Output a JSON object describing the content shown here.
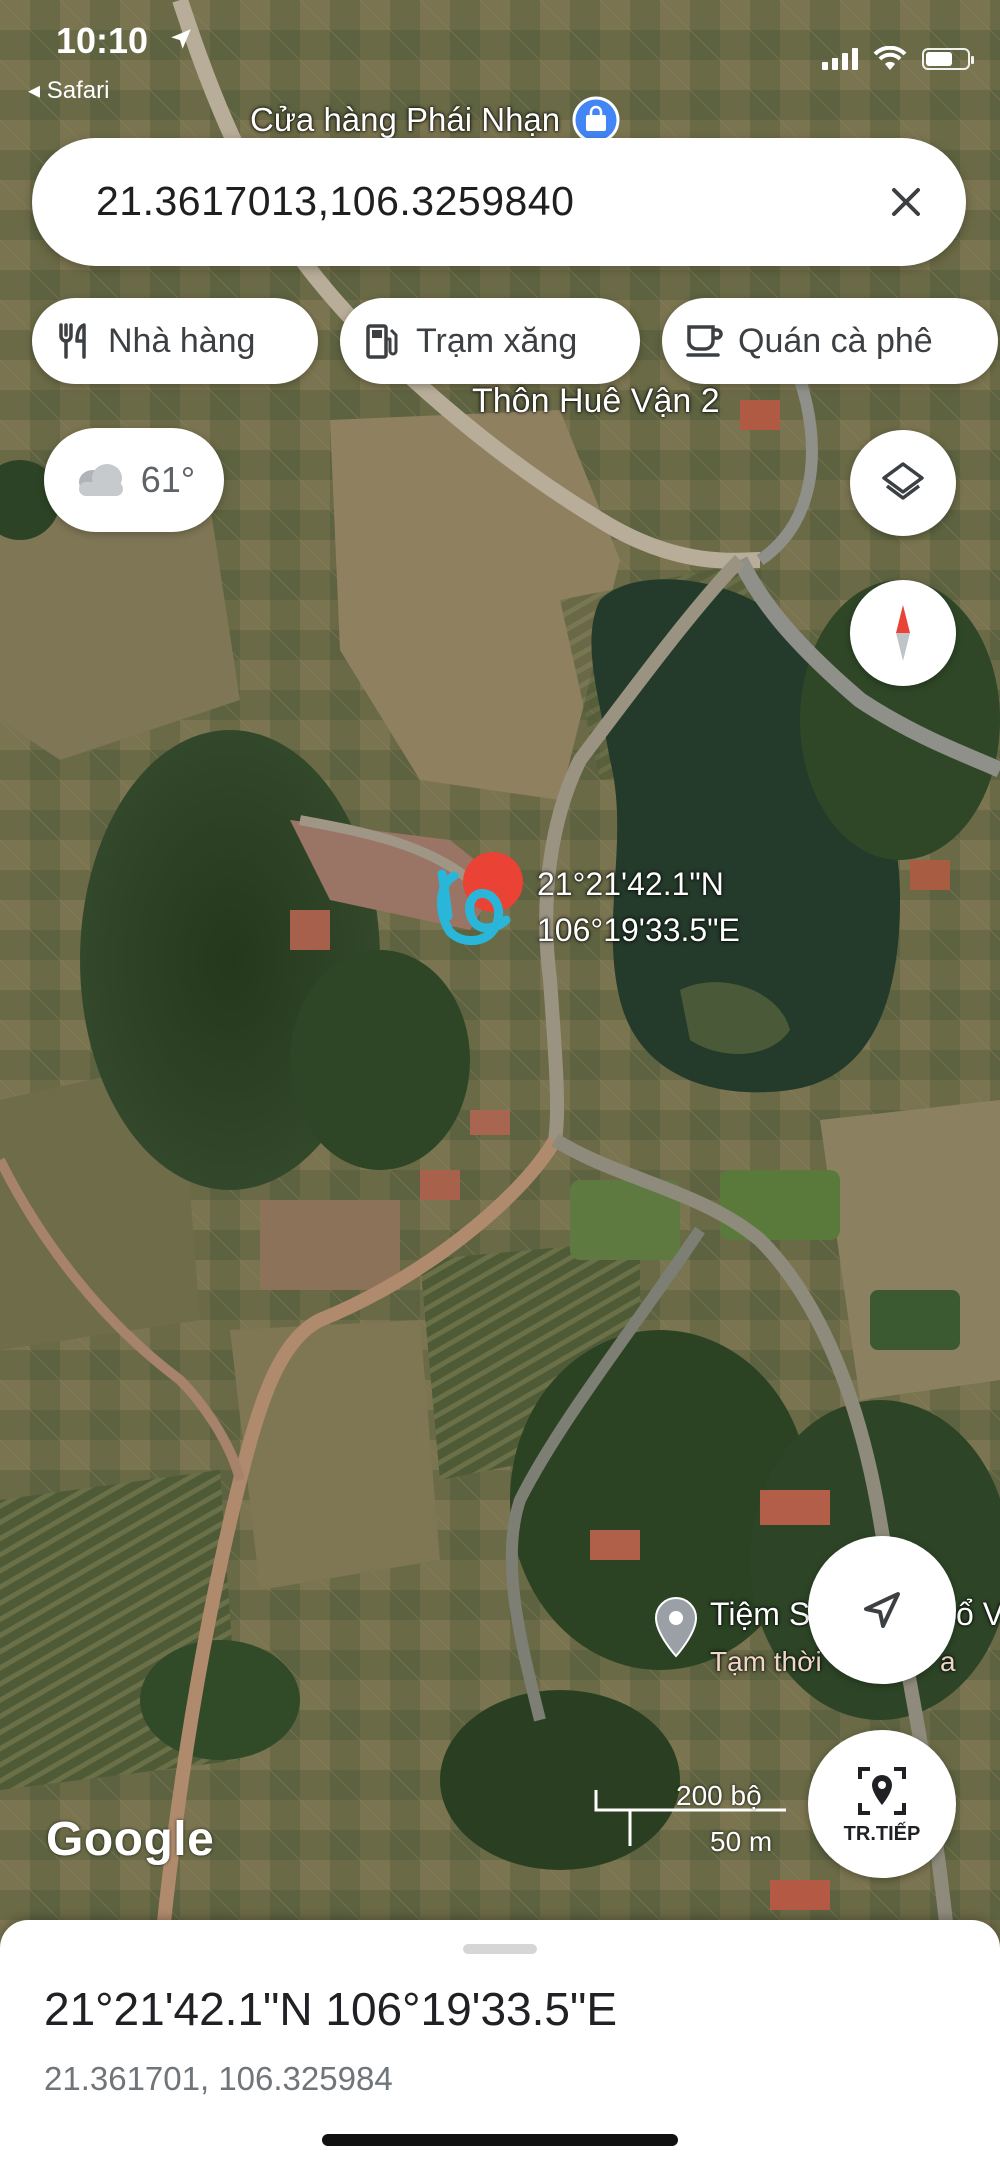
{
  "status_bar": {
    "time": "10:10",
    "back_label": "◂ Safari"
  },
  "map": {
    "top_place_label": "Cửa hàng Phái Nhạn",
    "village_label": "Thôn Huê Vận 2",
    "coordinate_marker": {
      "lat_dms": "21°21'42.1\"N",
      "lng_dms": "106°19'33.5\"E"
    },
    "poi": {
      "name": "Tiệm S",
      "name_tail": "ổ V",
      "status": "Tạm thời",
      "status_tail": "a"
    },
    "scale": {
      "imperial": "200 bộ",
      "metric": "50 m"
    },
    "attribution": "Google"
  },
  "search": {
    "query": "21.3617013,106.3259840"
  },
  "chips": [
    {
      "label": "Nhà hàng",
      "icon": "restaurant-icon"
    },
    {
      "label": "Trạm xăng",
      "icon": "gas-station-icon"
    },
    {
      "label": "Quán cà phê",
      "icon": "coffee-icon"
    }
  ],
  "weather": {
    "temperature": "61°",
    "icon": "cloudy-icon"
  },
  "buttons": {
    "live_view_label": "TR.TIẾP"
  },
  "bottom_sheet": {
    "title": "21°21'42.1\"N 106°19'33.5\"E",
    "subtitle": "21.361701, 106.325984"
  },
  "colors": {
    "chip_icon": "#3c4043",
    "marker": "#ea4335",
    "annotation": "#29b6d8",
    "compass_red": "#ea4335"
  }
}
